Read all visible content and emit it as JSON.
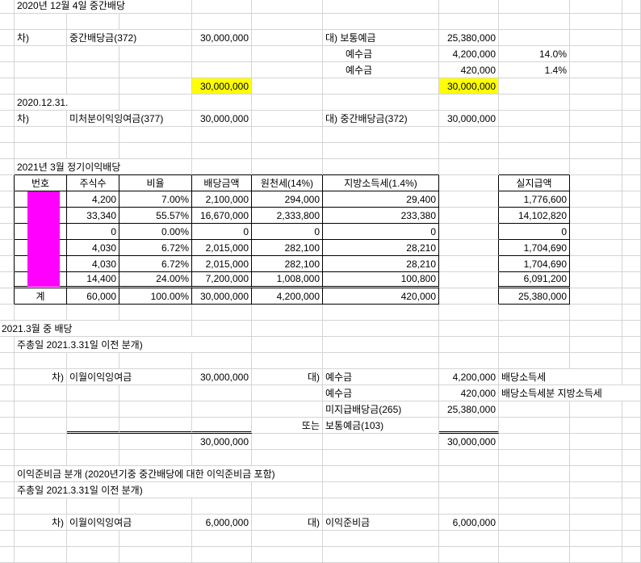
{
  "colors": {
    "highlight": "#ffff00",
    "redaction": "#ff00ff",
    "gridline": "#d4d4d4"
  },
  "interim": {
    "title": "2020년 12월 4일 중간배당",
    "dr_label": "차)",
    "dr_account": "중간배당금(372)",
    "dr_amount": "30,000,000",
    "cr_lines": [
      {
        "label": "대) 보통예금",
        "amount": "25,380,000"
      },
      {
        "label": "예수금",
        "amount": "4,200,000",
        "rate": "14.0%"
      },
      {
        "label": "예수금",
        "amount": "420,000",
        "rate": "1.4%"
      }
    ],
    "dr_total": "30,000,000",
    "cr_total": "30,000,000"
  },
  "closing": {
    "date": "2020.12.31.",
    "dr_label": "차)",
    "dr_account": "미처분이익잉여금(377)",
    "dr_amount": "30,000,000",
    "cr_label": "대) 중간배당금(372)",
    "cr_amount": "30,000,000"
  },
  "dividend_table": {
    "title": "2021년 3월 정기이익배당",
    "headers": [
      "번호",
      "주식수",
      "비율",
      "배당금액",
      "원천세(14%)",
      "지방소득세(1.4%)"
    ],
    "net_header": "실지급액",
    "rows": [
      {
        "shares": "4,200",
        "ratio": "7.00%",
        "amount": "2,100,000",
        "withholding": "294,000",
        "local": "29,400",
        "net": "1,776,600"
      },
      {
        "shares": "33,340",
        "ratio": "55.57%",
        "amount": "16,670,000",
        "withholding": "2,333,800",
        "local": "233,380",
        "net": "14,102,820"
      },
      {
        "shares": "0",
        "ratio": "0.00%",
        "amount": "0",
        "withholding": "0",
        "local": "0",
        "net": "0"
      },
      {
        "shares": "4,030",
        "ratio": "6.72%",
        "amount": "2,015,000",
        "withholding": "282,100",
        "local": "28,210",
        "net": "1,704,690"
      },
      {
        "shares": "4,030",
        "ratio": "6.72%",
        "amount": "2,015,000",
        "withholding": "282,100",
        "local": "28,210",
        "net": "1,704,690"
      },
      {
        "shares": "14,400",
        "ratio": "24.00%",
        "amount": "7,200,000",
        "withholding": "1,008,000",
        "local": "100,800",
        "net": "6,091,200"
      }
    ],
    "total": {
      "label": "계",
      "shares": "60,000",
      "ratio": "100.00%",
      "amount": "30,000,000",
      "withholding": "4,200,000",
      "local": "420,000",
      "net": "25,380,000"
    }
  },
  "march": {
    "title": "2021.3월 중 배당",
    "subtitle": "주총일 2021.3.31일 이전 분개)",
    "dr_label": "차)",
    "dr_account": "이월이익잉여금",
    "dr_amount": "30,000,000",
    "cr_label": "대)",
    "alt_label": "또는",
    "cr_lines": [
      {
        "account": "예수금",
        "amount": "4,200,000",
        "note": "배당소득세"
      },
      {
        "account": "예수금",
        "amount": "420,000",
        "note": "배당소득세분 지방소득세"
      },
      {
        "account": "미지급배당금(265)",
        "amount": "25,380,000"
      },
      {
        "account": "보통예금(103)"
      }
    ],
    "dr_total": "30,000,000",
    "cr_total": "30,000,000"
  },
  "reserve": {
    "title": "이익준비금 분개 (2020년기중 중간배당에 대한 이익준비금 포함)",
    "subtitle": "주총일 2021.3.31일 이전 분개)",
    "dr_label": "차)",
    "dr_account": "이월이익잉여금",
    "dr_amount": "6,000,000",
    "cr_label": "대)",
    "cr_account": "이익준비금",
    "cr_amount": "6,000,000"
  }
}
